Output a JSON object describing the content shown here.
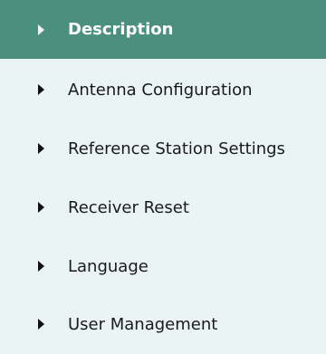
{
  "menu": {
    "items": [
      {
        "label": "Description",
        "active": true
      },
      {
        "label": "Antenna Configuration",
        "active": false
      },
      {
        "label": "Reference Station Settings",
        "active": false
      },
      {
        "label": "Receiver Reset",
        "active": false
      },
      {
        "label": "Language",
        "active": false
      },
      {
        "label": "User Management",
        "active": false
      }
    ]
  },
  "colors": {
    "active_bg": "#4b907f",
    "menu_bg": "#eaf4f4",
    "text": "#1a1a1a",
    "active_text": "#ffffff"
  },
  "icons": {
    "item_marker": "triangle-right-icon"
  }
}
